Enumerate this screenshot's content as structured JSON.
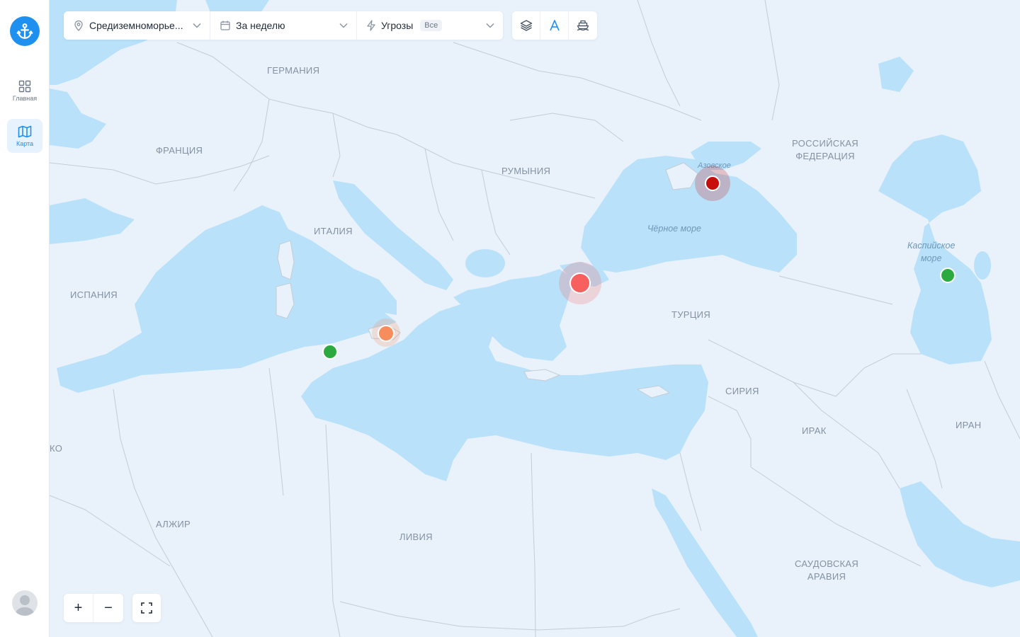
{
  "sidebar": {
    "items": [
      {
        "label": "Главная",
        "icon": "grid-icon",
        "active": false
      },
      {
        "label": "Карта",
        "icon": "map-icon",
        "active": true
      }
    ]
  },
  "toolbar": {
    "region": "Средиземноморье...",
    "period": "За неделю",
    "threats_label": "Угрозы",
    "threats_badge": "Все"
  },
  "tools": [
    "layers-icon",
    "text-label-icon",
    "ship-icon"
  ],
  "zoom": {
    "in": "+",
    "out": "−"
  },
  "countries": [
    "ГЕРМАНИЯ",
    "ФРАНЦИЯ",
    "ИТАЛИЯ",
    "ИСПАНИЯ",
    "РУМЫНИЯ",
    "РОССИЙСКАЯ\nФЕДЕРАЦИЯ",
    "ТУРЦИЯ",
    "СИРИЯ",
    "ИРАК",
    "ИРАН",
    "АЛЖИР",
    "ЛИВИЯ",
    "САУДОВСКАЯ\nАРАВИЯ",
    "КО"
  ],
  "seas": [
    "Чёрное море",
    "Азовское",
    "Каспийское\nморе"
  ],
  "markers": [
    {
      "level": "critical",
      "color": "#c80d0d"
    },
    {
      "level": "high",
      "color": "#f86060"
    },
    {
      "level": "medium",
      "color": "#f78c5c"
    },
    {
      "level": "low",
      "color": "#2daa3f"
    },
    {
      "level": "low",
      "color": "#2daa3f"
    }
  ],
  "colors": {
    "water": "#b9e2fa",
    "land": "#e9f2fb",
    "border": "#c3ccd6",
    "accent": "#1e90f0"
  }
}
